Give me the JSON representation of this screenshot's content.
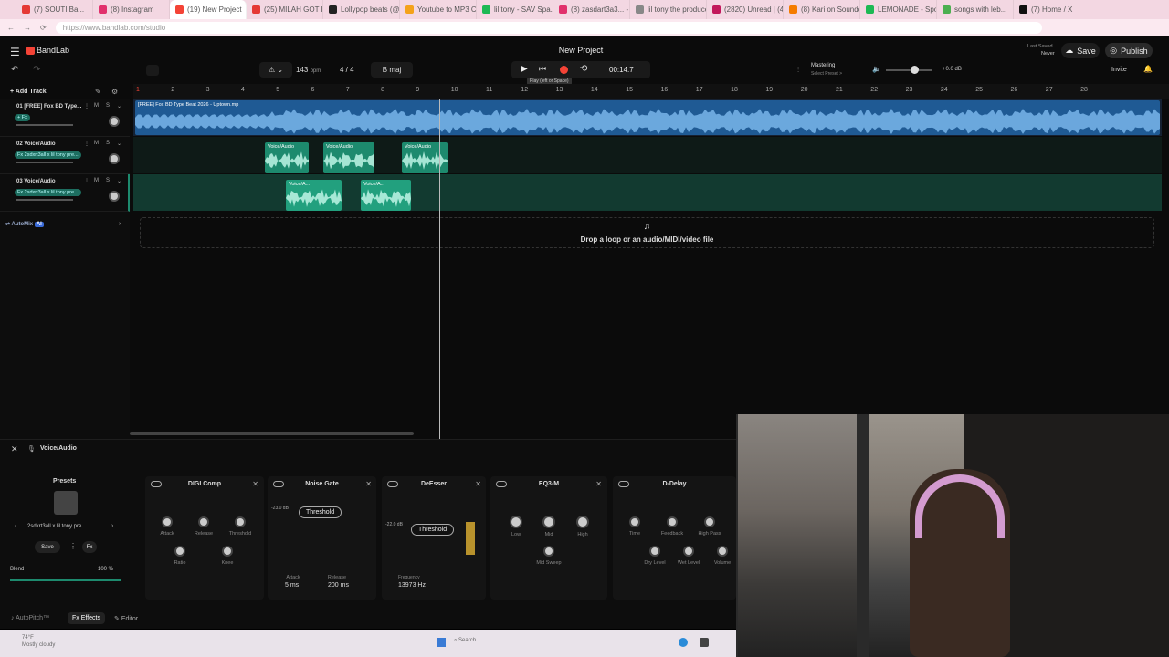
{
  "browser": {
    "tabs": [
      {
        "label": "(7) SOUTI Ba..."
      },
      {
        "label": "(8) Instagram"
      },
      {
        "label": "(19) New Project",
        "active": true
      },
      {
        "label": "(25) MILAH GOT IC"
      },
      {
        "label": "Lollypop beats (@bli..."
      },
      {
        "label": "Youtube to MP3 Co..."
      },
      {
        "label": "lil tony - SAV Spa..."
      },
      {
        "label": "(8) zasdart3a3... - Insta..."
      },
      {
        "label": "lil tony the producer..."
      },
      {
        "label": "(2820) Unread | (4)..."
      },
      {
        "label": "(8) Kari on Soundc..."
      },
      {
        "label": "LEMONADE - Spot..."
      },
      {
        "label": "songs with leb..."
      },
      {
        "label": "(7) Home / X"
      }
    ],
    "url": "https://www.bandlab.com/studio"
  },
  "app": {
    "logo": "BandLab",
    "project_title": "New Project",
    "tempo": "143",
    "tempo_unit": "bpm",
    "time_signature": "4 / 4",
    "key": "B maj",
    "time_display": "00:14.7",
    "tooltip": "Play (left or Space)",
    "mastering": "Mastering",
    "mastering_sub": "Select Preset >",
    "master_volume": "+0.0 dB",
    "last_saved_label": "Last Saved",
    "last_saved_value": "Never",
    "save_label": "Save",
    "publish_label": "Publish",
    "invite_label": "Invite",
    "add_track_label": "Add Track",
    "automix_label": "AutoMix",
    "automix_badge": "AI",
    "drop_text": "Drop a loop or an audio/MIDI/video file"
  },
  "ruler": [
    "1",
    "2",
    "3",
    "4",
    "5",
    "6",
    "7",
    "8",
    "9",
    "10",
    "11",
    "12",
    "13",
    "14",
    "15",
    "16",
    "17",
    "18",
    "19",
    "20",
    "21",
    "22",
    "23",
    "24",
    "25",
    "26",
    "27",
    "28"
  ],
  "tracks": [
    {
      "name": "01  [FREE] Fox BD Type...",
      "fx": "+ Fx",
      "m": "M",
      "s": "S"
    },
    {
      "name": "02  Voice/Audio",
      "fx": "Fx 2sdxrt3all x lil tony pre...",
      "m": "M",
      "s": "S"
    },
    {
      "name": "03  Voice/Audio",
      "fx": "Fx 2sdxrt3all x lil tony pre...",
      "m": "M",
      "s": "S"
    }
  ],
  "clips": {
    "beat_title": "[FREE] Fox BD Type Beat 2026 - Uptown.mp",
    "voice_label": "Voice/Audio",
    "voice_label_b": "Voice/A..."
  },
  "fx_panel": {
    "track_label": "Voice/Audio",
    "presets_title": "Presets",
    "preset_name": "2sdxrt3all x lil tony pre...",
    "save_label": "Save",
    "blend_label": "Blend",
    "blend_value": "100 %",
    "devices": {
      "digi": {
        "title": "DIGI Comp",
        "attack": "Attack",
        "release": "Release",
        "threshold": "Threshold",
        "ratio": "Ratio",
        "knee": "Knee"
      },
      "gate": {
        "title": "Noise Gate",
        "db": "-23.0 dB",
        "threshold": "Threshold",
        "attack_label": "Attack",
        "attack_value": "5 ms",
        "release_label": "Release",
        "release_value": "200 ms"
      },
      "deesser": {
        "title": "DeEsser",
        "db": "-22.0 dB",
        "threshold": "Threshold",
        "freq_label": "Frequency",
        "freq_value": "13973 Hz"
      },
      "eq": {
        "title": "EQ3-M",
        "low": "Low",
        "mid": "Mid",
        "high": "High",
        "sweep": "Mid Sweep"
      },
      "delay": {
        "title": "D-Delay",
        "time": "Time",
        "feedback": "Feedback",
        "highpass": "High Pass",
        "dry": "Dry Level",
        "wet": "Wet Level",
        "volume": "Volume"
      }
    },
    "bottom_tabs": [
      "AutoPitch™",
      "Effects",
      "Editor"
    ]
  },
  "taskbar": {
    "weather": "74°F",
    "weather_sub": "Mostly cloudy",
    "search": "Search"
  },
  "colors": {
    "accent": "#f44336",
    "clip_beat": "#1f5a94",
    "clip_voice": "#1d8a6e",
    "lane_bg": "#123a30"
  }
}
